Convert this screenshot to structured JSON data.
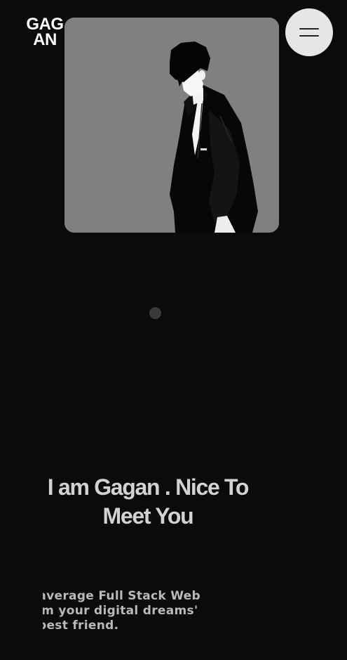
{
  "logo": {
    "line1": "GAG",
    "line2": "AN"
  },
  "menu": {
    "icon": "hamburger-menu-icon"
  },
  "portrait": {
    "icon": "portrait-illustration",
    "background": "#808080"
  },
  "headline": {
    "line1": "I am Gagan . Nice To",
    "line2": "Meet You"
  },
  "intro": {
    "line1": "an average Full Stack Web",
    "line2": "I'm your digital dreams'",
    "line3": "best friend."
  },
  "colors": {
    "background": "#0b0b0b",
    "menu_button": "#e6e6e6",
    "headline_text": "#d2d2d2",
    "intro_text": "#b9b9b9"
  }
}
